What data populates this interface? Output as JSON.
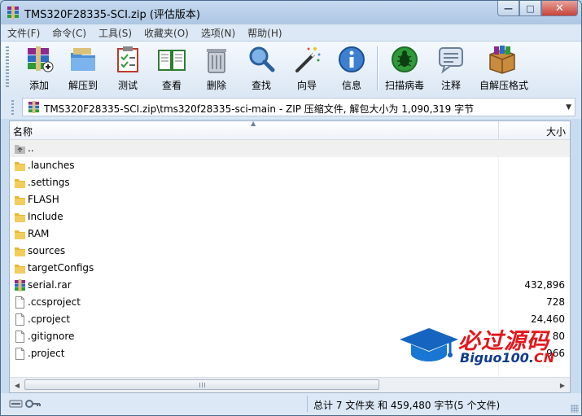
{
  "window": {
    "title": "TMS320F28335-SCI.zip (评估版本)",
    "min_glyph": "—",
    "max_glyph": "□",
    "close_glyph": "✕"
  },
  "menu": [
    "文件(F)",
    "命令(C)",
    "工具(S)",
    "收藏夹(O)",
    "选项(N)",
    "帮助(H)"
  ],
  "toolbar": {
    "add": "添加",
    "extract": "解压到",
    "test": "测试",
    "view": "查看",
    "delete": "删除",
    "find": "查找",
    "wizard": "向导",
    "info": "信息",
    "scan": "扫描病毒",
    "comment": "注释",
    "sfx": "自解压格式"
  },
  "address": {
    "path": "TMS320F28335-SCI.zip\\tms320f28335-sci-main - ZIP 压缩文件, 解包大小为 1,090,319 字节",
    "dropdown_glyph": "▼"
  },
  "columns": {
    "name": "名称",
    "size": "大小",
    "sort_glyph": "▲"
  },
  "files": [
    {
      "name": "..",
      "size": "",
      "type": "up"
    },
    {
      "name": ".launches",
      "size": "",
      "type": "folder"
    },
    {
      "name": ".settings",
      "size": "",
      "type": "folder"
    },
    {
      "name": "FLASH",
      "size": "",
      "type": "folder"
    },
    {
      "name": "Include",
      "size": "",
      "type": "folder"
    },
    {
      "name": "RAM",
      "size": "",
      "type": "folder"
    },
    {
      "name": "sources",
      "size": "",
      "type": "folder"
    },
    {
      "name": "targetConfigs",
      "size": "",
      "type": "folder"
    },
    {
      "name": "serial.rar",
      "size": "432,896",
      "type": "rar"
    },
    {
      "name": ".ccsproject",
      "size": "728",
      "type": "file"
    },
    {
      "name": ".cproject",
      "size": "24,460",
      "type": "file"
    },
    {
      "name": ".gitignore",
      "size": "80",
      "type": "file"
    },
    {
      "name": ".project",
      "size": "966",
      "type": "file"
    }
  ],
  "scrollbar": {
    "left_glyph": "◀",
    "right_glyph": "▶"
  },
  "status": {
    "summary": "总计 7 文件夹 和 459,480 字节(5 个文件)"
  },
  "watermark": {
    "cn": "必过源码",
    "en_main": "Biguo100.",
    "en_cn": "CN"
  },
  "colors": {
    "folder": "#e8b835",
    "accent": "#4a6b8f",
    "close": "#c7443a",
    "watermark_red": "#e4161b",
    "watermark_blue": "#0f3b8c"
  }
}
